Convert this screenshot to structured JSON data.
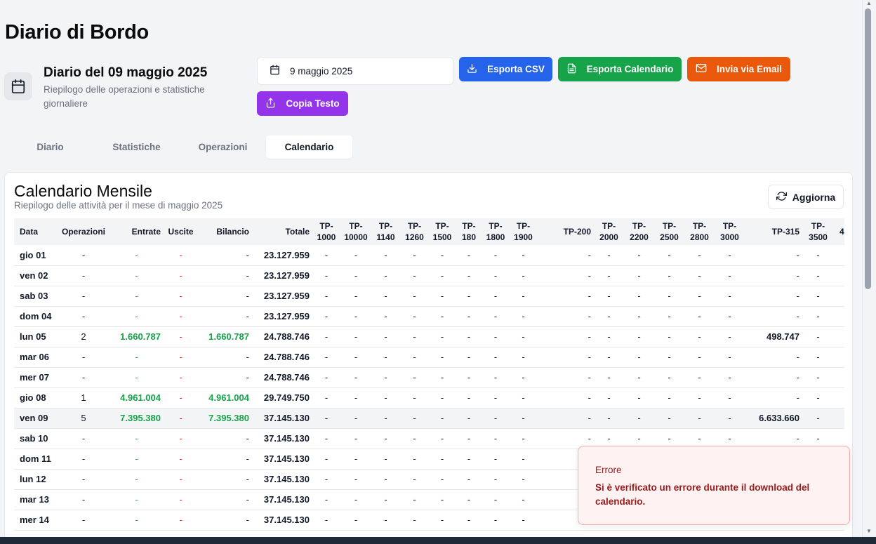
{
  "app": {
    "title": "Diario di Bordo"
  },
  "header": {
    "title": "Diario del 09 maggio 2025",
    "subtitle": "Riepilogo delle operazioni e statistiche giornaliere",
    "icon": "calendar-icon"
  },
  "toolbar": {
    "date_value": "9 maggio 2025",
    "export_csv": "Esporta CSV",
    "export_calendar": "Esporta Calendario",
    "send_email": "Invia via Email",
    "copy_text": "Copia Testo"
  },
  "colors": {
    "csv": "#2563eb",
    "calendar": "#16a34a",
    "email": "#ea580c",
    "copy": "#9333ea",
    "positive": "#16a34a",
    "negative": "#dc2626"
  },
  "tabs": [
    {
      "label": "Diario",
      "active": false
    },
    {
      "label": "Statistiche",
      "active": false
    },
    {
      "label": "Operazioni",
      "active": false
    },
    {
      "label": "Calendario",
      "active": true
    }
  ],
  "calendar": {
    "title": "Calendario Mensile",
    "subtitle": "Riepilogo delle attività per il mese di maggio 2025",
    "refresh_label": "Aggiorna",
    "columns": {
      "data": "Data",
      "operazioni": "Operazioni",
      "entrate": "Entrate",
      "uscite": "Uscite",
      "bilancio": "Bilancio",
      "totale": "Totale",
      "tp1000": "TP-1000",
      "tp10000": "TP-10000",
      "tp1140": "TP-1140",
      "tp1260": "TP-1260",
      "tp1500": "TP-1500",
      "tp180": "TP-180",
      "tp1800": "TP-1800",
      "tp1900": "TP-1900",
      "tp200": "TP-200",
      "tp2000": "TP-2000",
      "tp2200": "TP-2200",
      "tp2500": "TP-2500",
      "tp2800": "TP-2800",
      "tp3000": "TP-3000",
      "tp315": "TP-315",
      "tp3500": "TP-3500",
      "next": "4"
    },
    "rows": [
      {
        "day": "gio 01",
        "ops": "-",
        "in": "-",
        "out": "-",
        "bal": "-",
        "tot": "23.127.959",
        "tp315": "-"
      },
      {
        "day": "ven 02",
        "ops": "-",
        "in": "-",
        "out": "-",
        "bal": "-",
        "tot": "23.127.959",
        "tp315": "-"
      },
      {
        "day": "sab 03",
        "ops": "-",
        "in": "-",
        "out": "-",
        "bal": "-",
        "tot": "23.127.959",
        "tp315": "-"
      },
      {
        "day": "dom 04",
        "ops": "-",
        "in": "-",
        "out": "-",
        "bal": "-",
        "tot": "23.127.959",
        "tp315": "-"
      },
      {
        "day": "lun 05",
        "ops": "2",
        "in": "1.660.787",
        "out": "-",
        "bal": "1.660.787",
        "tot": "24.788.746",
        "tp315": "498.747"
      },
      {
        "day": "mar 06",
        "ops": "-",
        "in": "-",
        "out": "-",
        "bal": "-",
        "tot": "24.788.746",
        "tp315": "-"
      },
      {
        "day": "mer 07",
        "ops": "-",
        "in": "-",
        "out": "-",
        "bal": "-",
        "tot": "24.788.746",
        "tp315": "-"
      },
      {
        "day": "gio 08",
        "ops": "1",
        "in": "4.961.004",
        "out": "-",
        "bal": "4.961.004",
        "tot": "29.749.750",
        "tp315": "-"
      },
      {
        "day": "ven 09",
        "ops": "5",
        "in": "7.395.380",
        "out": "-",
        "bal": "7.395.380",
        "tot": "37.145.130",
        "tp315": "6.633.660",
        "selected": true
      },
      {
        "day": "sab 10",
        "ops": "-",
        "in": "-",
        "out": "-",
        "bal": "-",
        "tot": "37.145.130",
        "tp315": "-"
      },
      {
        "day": "dom 11",
        "ops": "-",
        "in": "-",
        "out": "-",
        "bal": "-",
        "tot": "37.145.130",
        "tp315": "-"
      },
      {
        "day": "lun 12",
        "ops": "-",
        "in": "-",
        "out": "-",
        "bal": "-",
        "tot": "37.145.130",
        "tp315": "-"
      },
      {
        "day": "mar 13",
        "ops": "-",
        "in": "-",
        "out": "-",
        "bal": "-",
        "tot": "37.145.130",
        "tp315": "-"
      },
      {
        "day": "mer 14",
        "ops": "-",
        "in": "-",
        "out": "-",
        "bal": "-",
        "tot": "37.145.130",
        "tp315": "-"
      }
    ],
    "empty_cell": "-"
  },
  "toast": {
    "title": "Errore",
    "message": "Si è verificato un errore durante il download del calendario."
  }
}
